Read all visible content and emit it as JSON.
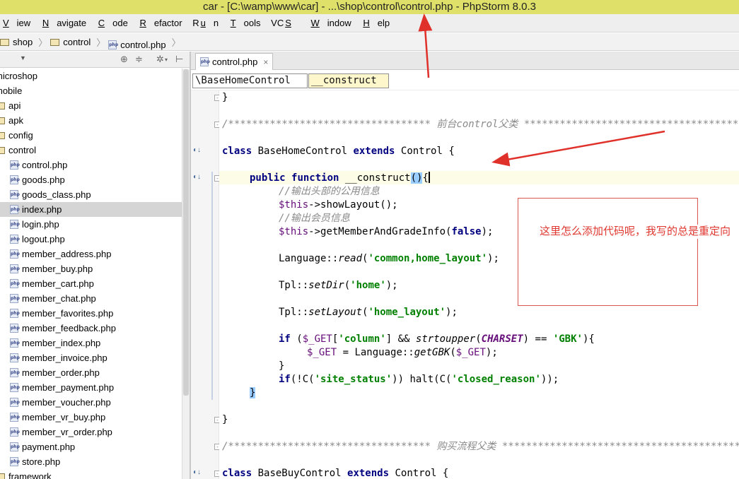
{
  "window": {
    "title": "car - [C:\\wamp\\www\\car] - ...\\shop\\control\\control.php - PhpStorm 8.0.3"
  },
  "menu": [
    {
      "label": "View",
      "mn": "V"
    },
    {
      "label": "Navigate",
      "mn": "N"
    },
    {
      "label": "Code",
      "mn": "C"
    },
    {
      "label": "Refactor",
      "mn": "R"
    },
    {
      "label": "Run",
      "mn": "u"
    },
    {
      "label": "Tools",
      "mn": "T"
    },
    {
      "label": "VCS",
      "mn": "S"
    },
    {
      "label": "Window",
      "mn": "W"
    },
    {
      "label": "Help",
      "mn": "H"
    }
  ],
  "navbar": {
    "crumbs": [
      "shop",
      "control",
      "control.php"
    ]
  },
  "project": {
    "dropdown_icon": "dropdown-arrow-icon",
    "items": [
      {
        "label": "microshop",
        "type": "folder"
      },
      {
        "label": "mobile",
        "type": "folder"
      },
      {
        "label": "api",
        "type": "folder"
      },
      {
        "label": "apk",
        "type": "folder"
      },
      {
        "label": "config",
        "type": "folder"
      },
      {
        "label": "control",
        "type": "folder"
      },
      {
        "label": "control.php",
        "type": "php"
      },
      {
        "label": "goods.php",
        "type": "php"
      },
      {
        "label": "goods_class.php",
        "type": "php"
      },
      {
        "label": "index.php",
        "type": "php",
        "selected": true
      },
      {
        "label": "login.php",
        "type": "php"
      },
      {
        "label": "logout.php",
        "type": "php"
      },
      {
        "label": "member_address.php",
        "type": "php"
      },
      {
        "label": "member_buy.php",
        "type": "php"
      },
      {
        "label": "member_cart.php",
        "type": "php"
      },
      {
        "label": "member_chat.php",
        "type": "php"
      },
      {
        "label": "member_favorites.php",
        "type": "php"
      },
      {
        "label": "member_feedback.php",
        "type": "php"
      },
      {
        "label": "member_index.php",
        "type": "php"
      },
      {
        "label": "member_invoice.php",
        "type": "php"
      },
      {
        "label": "member_order.php",
        "type": "php"
      },
      {
        "label": "member_payment.php",
        "type": "php"
      },
      {
        "label": "member_voucher.php",
        "type": "php"
      },
      {
        "label": "member_vr_buy.php",
        "type": "php"
      },
      {
        "label": "member_vr_order.php",
        "type": "php"
      },
      {
        "label": "payment.php",
        "type": "php"
      },
      {
        "label": "store.php",
        "type": "php"
      },
      {
        "label": "framework",
        "type": "folder"
      }
    ]
  },
  "editor": {
    "tab_label": "control.php",
    "tab_close": "×",
    "class_crumb": "\\BaseHomeControl",
    "method_crumb": "__construct",
    "lines": {
      "l1": "}",
      "l2": "/********************************** 前台control父类 ****************************************/",
      "l3_kw": "class",
      "l3_name": " BaseHomeControl ",
      "l3_kw2": "extends",
      "l3_rest": " Control {",
      "l4_kw1": "public",
      "l4_kw2": "function",
      "l4_name": " __construct",
      "l4_paren": "()",
      "l4_brace": "{",
      "l5": "//输出头部的公用信息",
      "l6_var": "$this",
      "l6_rest": "->showLayout();",
      "l7": "//输出会员信息",
      "l8_var": "$this",
      "l8_mid": "->getMemberAndGradeInfo(",
      "l8_kw": "false",
      "l8_end": ");",
      "l9_a": "Language::",
      "l9_fn": "read",
      "l9_b": "(",
      "l9_str": "'common,home_layout'",
      "l9_c": ");",
      "l10_a": "Tpl::",
      "l10_fn": "setDir",
      "l10_b": "(",
      "l10_str": "'home'",
      "l10_c": ");",
      "l11_a": "Tpl::",
      "l11_fn": "setLayout",
      "l11_b": "(",
      "l11_str": "'home_layout'",
      "l11_c": ");",
      "l12_kw": "if",
      "l12_a": " (",
      "l12_var": "$_GET",
      "l12_b": "[",
      "l12_str": "'column'",
      "l12_c": "] && ",
      "l12_fn": "strtoupper",
      "l12_d": "(",
      "l12_const": "CHARSET",
      "l12_e": ") == ",
      "l12_str2": "'GBK'",
      "l12_f": "){",
      "l13_var": "$_GET",
      "l13_a": " = Language::",
      "l13_fn": "getGBK",
      "l13_b": "(",
      "l13_var2": "$_GET",
      "l13_c": ");",
      "l14": "}",
      "l15_kw": "if",
      "l15_a": "(!C(",
      "l15_str": "'site_status'",
      "l15_b": ")) halt(C(",
      "l15_str2": "'closed_reason'",
      "l15_c": "));",
      "l16": "}",
      "l17": "}",
      "l18": "/********************************** 购买流程父类 ****************************************/",
      "l19_kw": "class",
      "l19_name": " BaseBuyControl ",
      "l19_kw2": "extends",
      "l19_rest": " Control {"
    }
  },
  "annotation": {
    "text": "这里怎么添加代码呢，我写的总是重定向",
    "color": "#e03830"
  },
  "colors": {
    "title_bg": "#dfe06a",
    "arrow": "#e0302a",
    "keyword": "#000080",
    "string": "#008000"
  }
}
